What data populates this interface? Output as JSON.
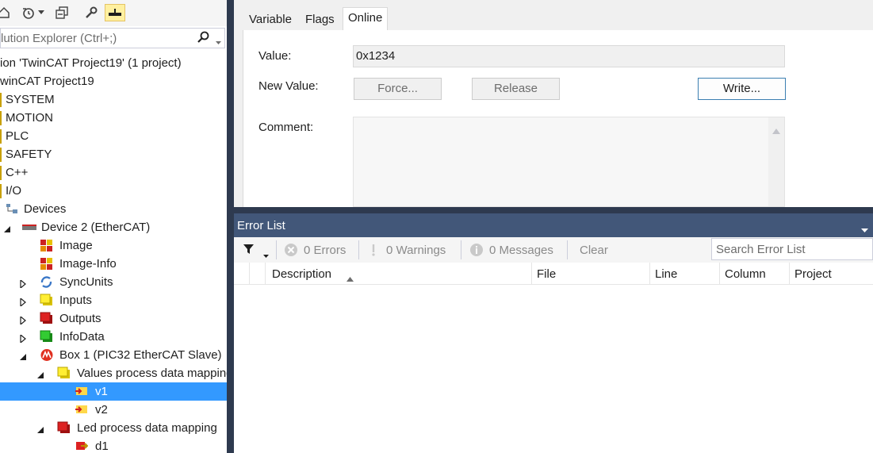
{
  "explorer": {
    "search_placeholder": "lution Explorer (Ctrl+;)",
    "tree": [
      {
        "label": "ion 'TwinCAT Project19' (1 project)"
      },
      {
        "label": "winCAT Project19"
      },
      {
        "label": "SYSTEM"
      },
      {
        "label": "MOTION"
      },
      {
        "label": "PLC"
      },
      {
        "label": "SAFETY"
      },
      {
        "label": "C++"
      },
      {
        "label": "I/O"
      },
      {
        "label": "Devices"
      },
      {
        "label": "Device 2 (EtherCAT)"
      },
      {
        "label": "Image"
      },
      {
        "label": "Image-Info"
      },
      {
        "label": "SyncUnits"
      },
      {
        "label": "Inputs"
      },
      {
        "label": "Outputs"
      },
      {
        "label": "InfoData"
      },
      {
        "label": "Box 1 (PIC32 EtherCAT Slave)"
      },
      {
        "label": "Values process data mapping"
      },
      {
        "label": "v1"
      },
      {
        "label": "v2"
      },
      {
        "label": "Led process data mapping"
      },
      {
        "label": "d1"
      }
    ]
  },
  "props": {
    "tabs": [
      "Variable",
      "Flags",
      "Online"
    ],
    "value_label": "Value:",
    "value": "0x1234",
    "new_value_label": "New Value:",
    "force_label": "Force...",
    "release_label": "Release",
    "write_label": "Write...",
    "comment_label": "Comment:"
  },
  "errorlist": {
    "title": "Error List",
    "errors": "0 Errors",
    "warnings": "0 Warnings",
    "messages": "0 Messages",
    "clear": "Clear",
    "search_placeholder": "Search Error List",
    "columns": [
      "Description",
      "File",
      "Line",
      "Column",
      "Project"
    ]
  },
  "colors": {
    "selection": "#3399ff",
    "splitter": "#2e3a4f",
    "errorlist_header": "#425779"
  }
}
